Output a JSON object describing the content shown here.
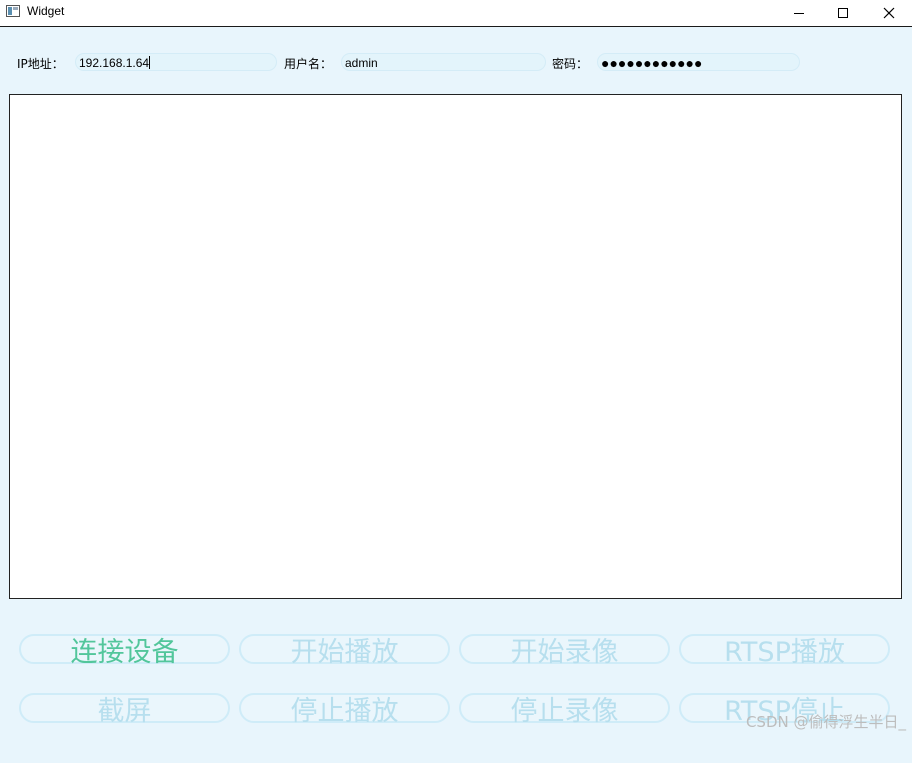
{
  "window": {
    "title": "Widget"
  },
  "form": {
    "ip_label": "IP地址：",
    "ip_value": "192.168.1.64",
    "user_label": "用户名：",
    "user_value": "admin",
    "password_label": "密码：",
    "password_value": "●●●●●●●●●●●●"
  },
  "buttons": {
    "connect": "连接设备",
    "start_play": "开始播放",
    "start_record": "开始录像",
    "rtsp_play": "RTSP播放",
    "screenshot": "截屏",
    "stop_play": "停止播放",
    "stop_record": "停止录像",
    "rtsp_stop": "RTSP停止"
  },
  "watermark": "CSDN @偷得浮生半日_",
  "colors": {
    "background": "#e8f5fc",
    "button_text_active": "#52c69b",
    "button_text_disabled": "#b7dfee",
    "button_border": "#cfecf8"
  },
  "icons": [
    "app-icon",
    "minimize-icon",
    "maximize-icon",
    "close-icon"
  ]
}
